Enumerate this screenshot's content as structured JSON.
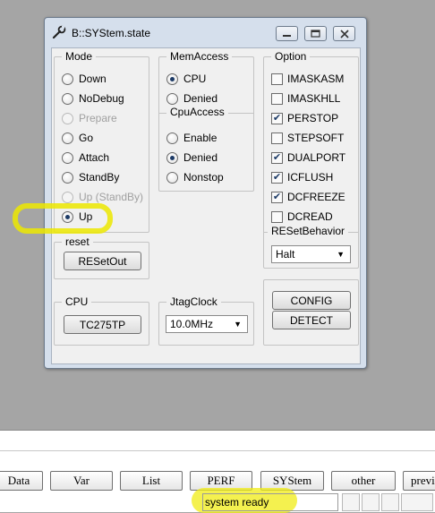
{
  "window": {
    "title": "B::SYStem.state",
    "controls": {
      "minimize": "minimize-icon",
      "restore": "restore-icon",
      "close": "close-icon"
    }
  },
  "mode": {
    "label": "Mode",
    "options": [
      {
        "label": "Down",
        "selected": false,
        "disabled": false
      },
      {
        "label": "NoDebug",
        "selected": false,
        "disabled": false
      },
      {
        "label": "Prepare",
        "selected": false,
        "disabled": true
      },
      {
        "label": "Go",
        "selected": false,
        "disabled": false
      },
      {
        "label": "Attach",
        "selected": false,
        "disabled": false
      },
      {
        "label": "StandBy",
        "selected": false,
        "disabled": false
      },
      {
        "label": "Up (StandBy)",
        "selected": false,
        "disabled": true
      },
      {
        "label": "Up",
        "selected": true,
        "disabled": false
      }
    ]
  },
  "memaccess": {
    "label": "MemAccess",
    "options": [
      {
        "label": "CPU",
        "selected": true
      },
      {
        "label": "Denied",
        "selected": false
      }
    ]
  },
  "cpuaccess": {
    "label": "CpuAccess",
    "options": [
      {
        "label": "Enable",
        "selected": false
      },
      {
        "label": "Denied",
        "selected": true
      },
      {
        "label": "Nonstop",
        "selected": false
      }
    ]
  },
  "option": {
    "label": "Option",
    "items": [
      {
        "label": "IMASKASM",
        "checked": false
      },
      {
        "label": "IMASKHLL",
        "checked": false
      },
      {
        "label": "PERSTOP",
        "checked": true
      },
      {
        "label": "STEPSOFT",
        "checked": false
      },
      {
        "label": "DUALPORT",
        "checked": true
      },
      {
        "label": "ICFLUSH",
        "checked": true
      },
      {
        "label": "DCFREEZE",
        "checked": true
      },
      {
        "label": "DCREAD",
        "checked": false
      }
    ]
  },
  "resetbehavior": {
    "label": "RESetBehavior",
    "value": "Halt"
  },
  "reset": {
    "label": "reset",
    "button": "RESetOut"
  },
  "cpu": {
    "label": "CPU",
    "button": "TC275TP"
  },
  "jtag": {
    "label": "JtagClock",
    "value": "10.0MHz"
  },
  "actions": {
    "config": "CONFIG",
    "detect": "DETECT"
  },
  "toolbar": [
    "Data",
    "Var",
    "List",
    "PERF",
    "SYStem",
    "other",
    "previ"
  ],
  "status": "system ready",
  "colors": {
    "highlight": "#ece800",
    "window_frame": "#d5dfec"
  }
}
